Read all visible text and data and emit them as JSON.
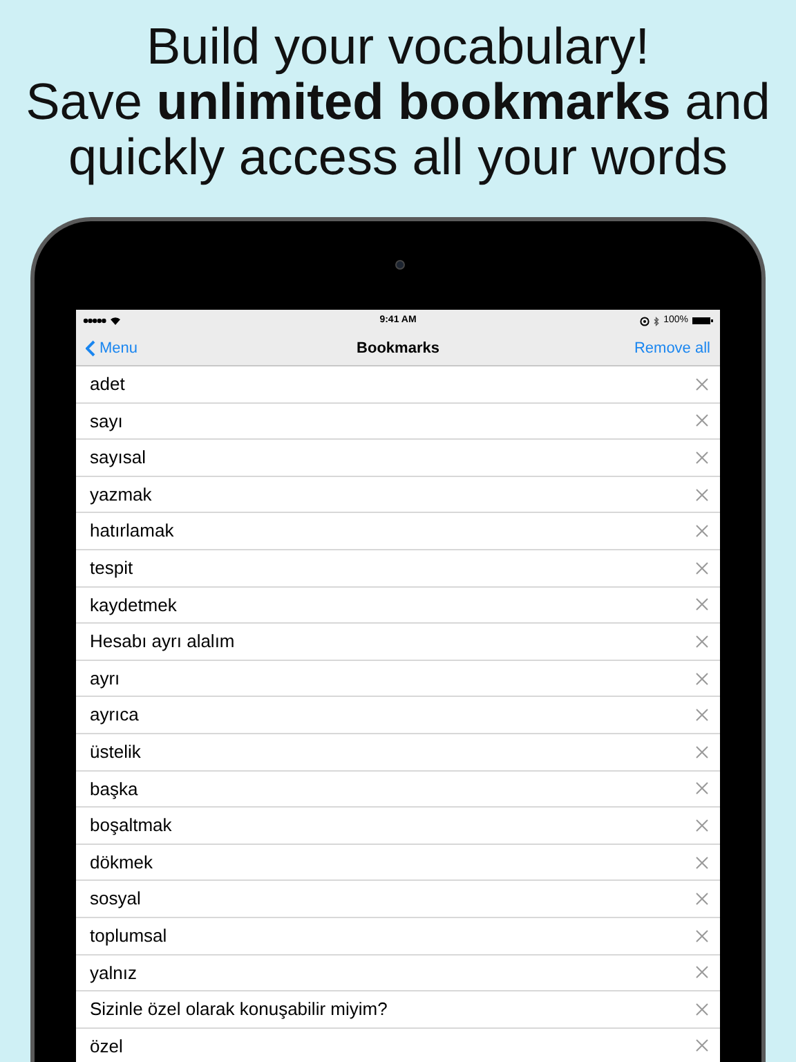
{
  "headline": [
    "Build your vocabulary!",
    "Save **unlimited bookmarks** and",
    "quickly access all your words"
  ],
  "status_bar": {
    "time": "9:41 AM",
    "battery": "100%"
  },
  "nav_bar": {
    "back": "Menu",
    "title": "Bookmarks",
    "action": "Remove all"
  },
  "bookmarks": [
    {
      "word": "adet"
    },
    {
      "word": "sayı"
    },
    {
      "word": "sayısal"
    },
    {
      "word": "yazmak"
    },
    {
      "word": "hatırlamak"
    },
    {
      "word": "tespit"
    },
    {
      "word": "kaydetmek"
    },
    {
      "word": "Hesabı ayrı alalım"
    },
    {
      "word": "ayrı"
    },
    {
      "word": "ayrıca"
    },
    {
      "word": "üstelik"
    },
    {
      "word": "başka"
    },
    {
      "word": "boşaltmak"
    },
    {
      "word": "dökmek"
    },
    {
      "word": "sosyal"
    },
    {
      "word": "toplumsal"
    },
    {
      "word": "yalnız"
    },
    {
      "word": "Sizinle özel olarak konuşabilir miyim?"
    },
    {
      "word": "özel"
    }
  ]
}
